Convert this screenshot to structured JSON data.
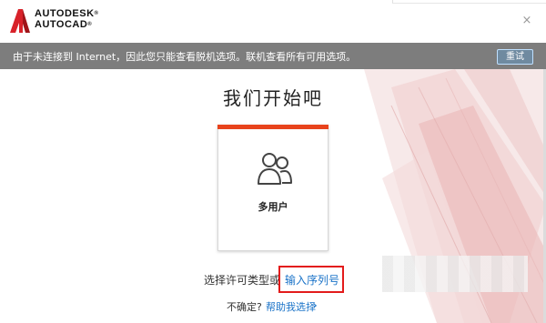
{
  "header": {
    "brand_line1": "AUTODESK",
    "brand_line1_mark": "®",
    "brand_line2": "AUTOCAD",
    "brand_line2_mark": "®",
    "close_label": "×"
  },
  "banner": {
    "message": "由于未连接到 Internet，因此您只能查看脱机选项。联机查看所有可用选项。",
    "retry_label": "重试"
  },
  "main": {
    "title": "我们开始吧",
    "card_label": "多用户",
    "card_icon": "multi-user-icon",
    "license_label": "选择许可类型或",
    "serial_link": "输入序列号"
  },
  "footer": {
    "unsure_label": "不确定?",
    "help_link": "帮助我选择",
    "chevron": "›"
  },
  "colors": {
    "accent": "#e8431c",
    "link": "#1a73c8",
    "banner_bg": "#7d7d7d",
    "highlight": "#e31b1b"
  }
}
